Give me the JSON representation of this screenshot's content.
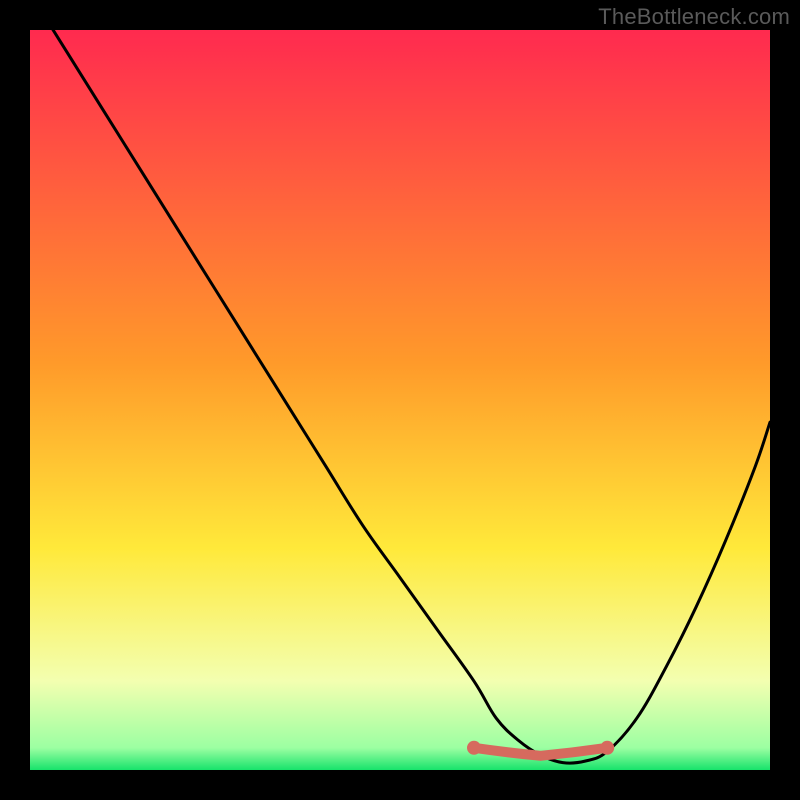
{
  "watermark": "TheBottleneck.com",
  "colors": {
    "gradient": [
      "#ff2a4f",
      "#ff9a2a",
      "#ffe93a",
      "#f3ffb0",
      "#9cffa2",
      "#17e36b"
    ],
    "curve": "#000000",
    "marker": "#d66a5e",
    "frame": "#000000"
  },
  "chart_data": {
    "type": "line",
    "title": "",
    "xlabel": "",
    "ylabel": "",
    "xlim": [
      0,
      100
    ],
    "ylim": [
      0,
      100
    ],
    "series": [
      {
        "name": "bottleneck-curve",
        "x": [
          0,
          5,
          10,
          15,
          20,
          25,
          30,
          35,
          40,
          45,
          50,
          55,
          60,
          63,
          66,
          69,
          72,
          75,
          78,
          82,
          86,
          90,
          94,
          98,
          100
        ],
        "values": [
          105,
          97,
          89,
          81,
          73,
          65,
          57,
          49,
          41,
          33,
          26,
          19,
          12,
          7,
          4,
          2,
          1,
          1.2,
          2.5,
          7,
          14,
          22,
          31,
          41,
          47
        ]
      }
    ],
    "optimal_range": {
      "x_start": 60,
      "x_end": 78,
      "y": 3
    },
    "annotations": []
  }
}
